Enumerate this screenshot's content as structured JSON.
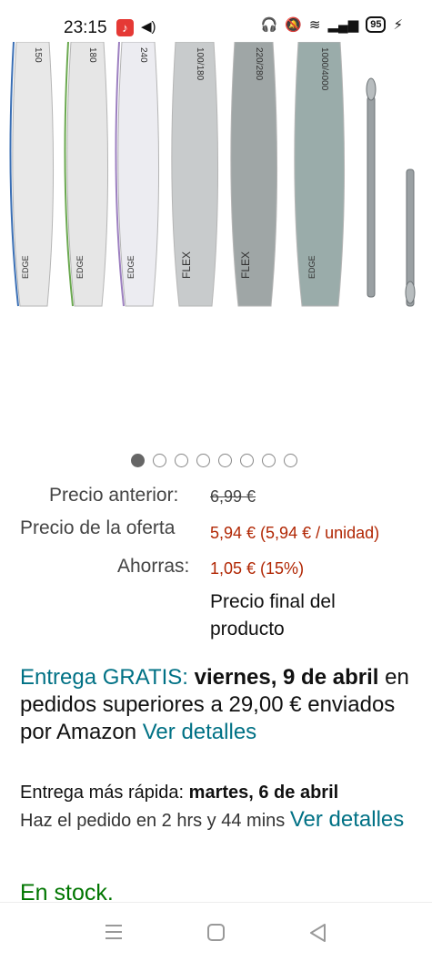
{
  "status_bar": {
    "time": "23:15",
    "battery": "95",
    "notif_glyph": "♪"
  },
  "gallery": {
    "file_grits": [
      "150",
      "180",
      "240",
      "100/180",
      "220/280",
      "1000/4000"
    ],
    "file_labels": [
      "EDGE",
      "EDGE",
      "EDGE",
      "FLEX",
      "FLEX",
      "EDGE"
    ],
    "file_colors": [
      "#3a6fb5",
      "#6aa84f",
      "#9c7fc0",
      "#c9c9c9",
      "#8e9595",
      "#7d9490"
    ],
    "dot_count": 8,
    "active_dot": 0
  },
  "pricing": {
    "old_label": "Precio anterior:",
    "old_value": "6,99 €",
    "offer_label": "Precio de la oferta",
    "offer_value": "5,94 € (5,94 € / unidad)",
    "save_label": "Ahorras:",
    "save_value": "1,05 € (15%)",
    "final_note": "Precio final del producto"
  },
  "delivery": {
    "prefix": "Entrega GRATIS:",
    "date": "viernes, 9 de abril",
    "rest": "en pedidos superiores a 29,00 € enviados por Amazon",
    "link": "Ver detalles"
  },
  "fast_delivery": {
    "label": "Entrega más rápida:",
    "date": "martes, 6 de abril",
    "order_text": "Haz el pedido en 2 hrs y 44 mins",
    "link": "Ver detalles"
  },
  "stock": "En stock."
}
